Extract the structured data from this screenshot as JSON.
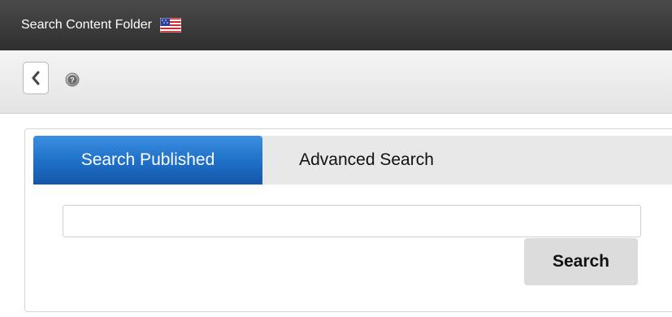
{
  "header": {
    "title": "Search Content Folder",
    "flag_icon": "us-flag-icon"
  },
  "toolbar": {
    "back_icon": "chevron-left-icon",
    "help_icon": "help-icon"
  },
  "tabs": [
    {
      "label": "Search Published",
      "active": true
    },
    {
      "label": "Advanced Search",
      "active": false
    }
  ],
  "search": {
    "value": "",
    "placeholder": "",
    "button_label": "Search"
  },
  "colors": {
    "titlebar": "#3a3a3a",
    "active_tab": "#1e6fc8",
    "search_button": "#dcdcdc"
  }
}
